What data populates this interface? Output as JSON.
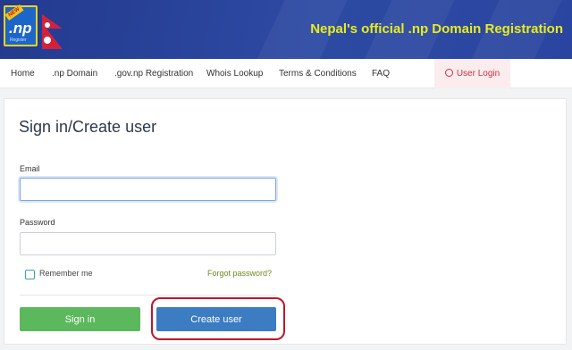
{
  "header": {
    "logo_text": ".np",
    "logo_sub": "Register",
    "logo_badge": "NEW",
    "site_title": "Nepal's official .np Domain Registration"
  },
  "nav": {
    "items": [
      "Home",
      ".np Domain",
      ".gov.np Registration",
      "Whois Lookup",
      "Terms & Conditions",
      "FAQ"
    ],
    "login_label": "User Login"
  },
  "form": {
    "title": "Sign in/Create user",
    "email_label": "Email",
    "email_value": "",
    "password_label": "Password",
    "password_value": "",
    "remember_label": "Remember me",
    "forgot_label": "Forgot password?",
    "signin_label": "Sign in",
    "create_label": "Create user"
  },
  "colors": {
    "header_bg": "#2a45a0",
    "title_yellow": "#e7ec1f",
    "signin_green": "#5cb85c",
    "create_blue": "#3b7cc2",
    "highlight_red": "#c3142b"
  }
}
